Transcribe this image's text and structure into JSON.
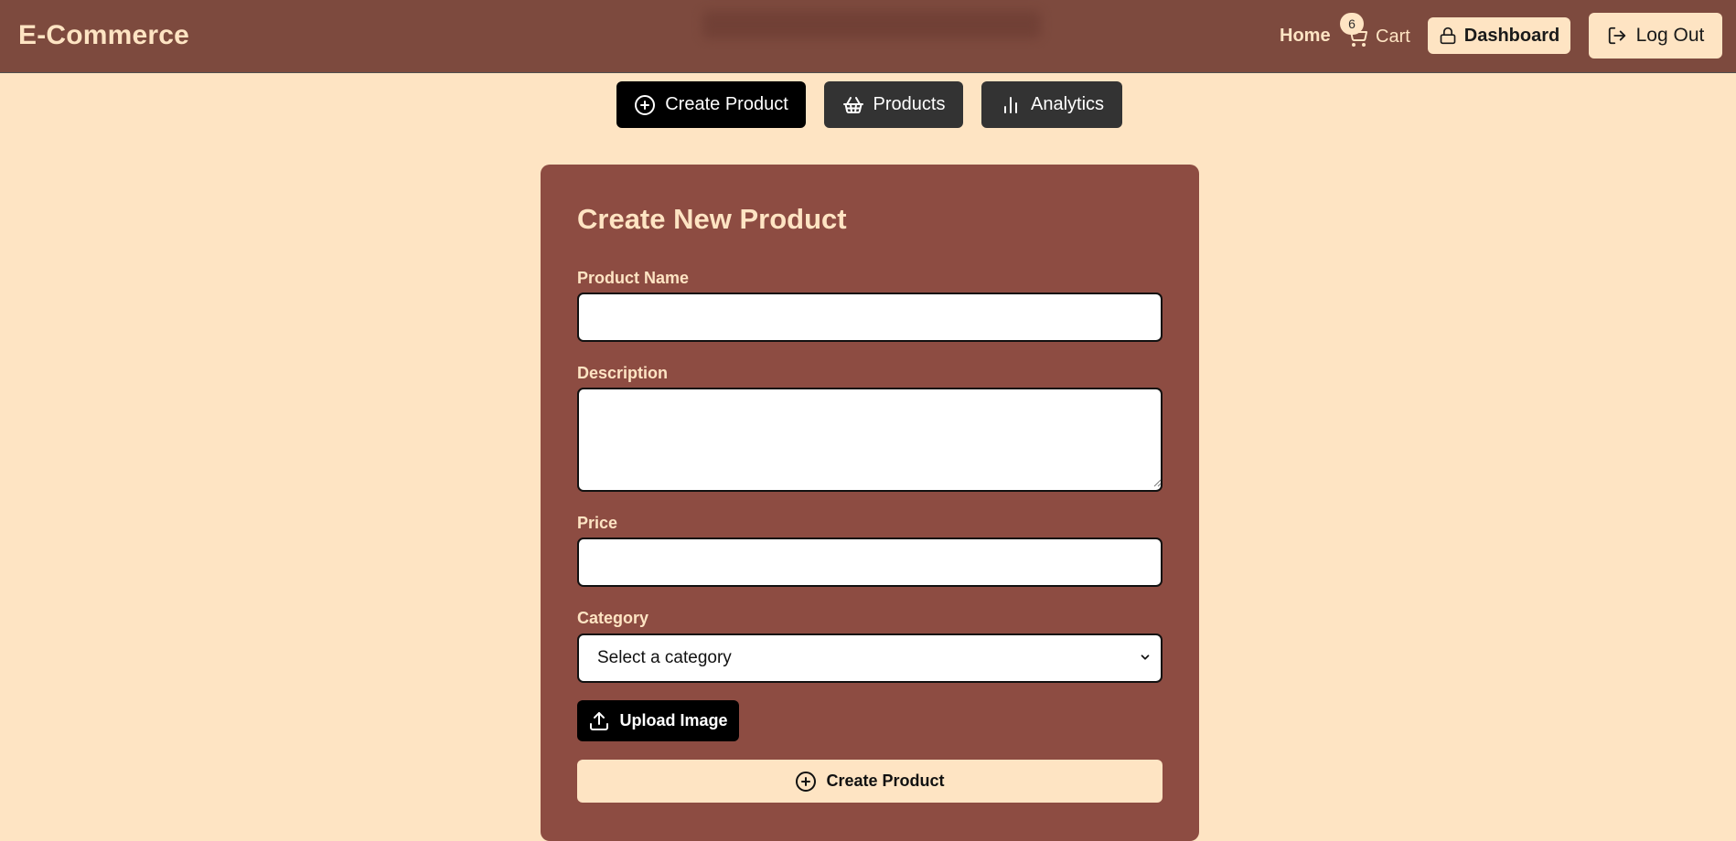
{
  "navbar": {
    "brand": "E-Commerce",
    "home_label": "Home",
    "cart_label": "Cart",
    "cart_count": "6",
    "dashboard_label": "Dashboard",
    "logout_label": "Log Out"
  },
  "tabs": [
    {
      "label": "Create Product",
      "icon": "plus-circle-icon",
      "active": true
    },
    {
      "label": "Products",
      "icon": "basket-icon",
      "active": false
    },
    {
      "label": "Analytics",
      "icon": "bar-chart-icon",
      "active": false
    }
  ],
  "form": {
    "title": "Create New Product",
    "name_label": "Product Name",
    "name_value": "",
    "description_label": "Description",
    "description_value": "",
    "price_label": "Price",
    "price_value": "",
    "category_label": "Category",
    "category_selected": "Select a category",
    "upload_label": "Upload Image",
    "submit_label": "Create Product"
  },
  "colors": {
    "page_bg": "#fee4c3",
    "navbar_bg": "#7d4a3e",
    "card_bg": "#8d4c42",
    "accent_light": "#fee4c3",
    "active_tab": "#000000",
    "inactive_tab": "#333333"
  }
}
